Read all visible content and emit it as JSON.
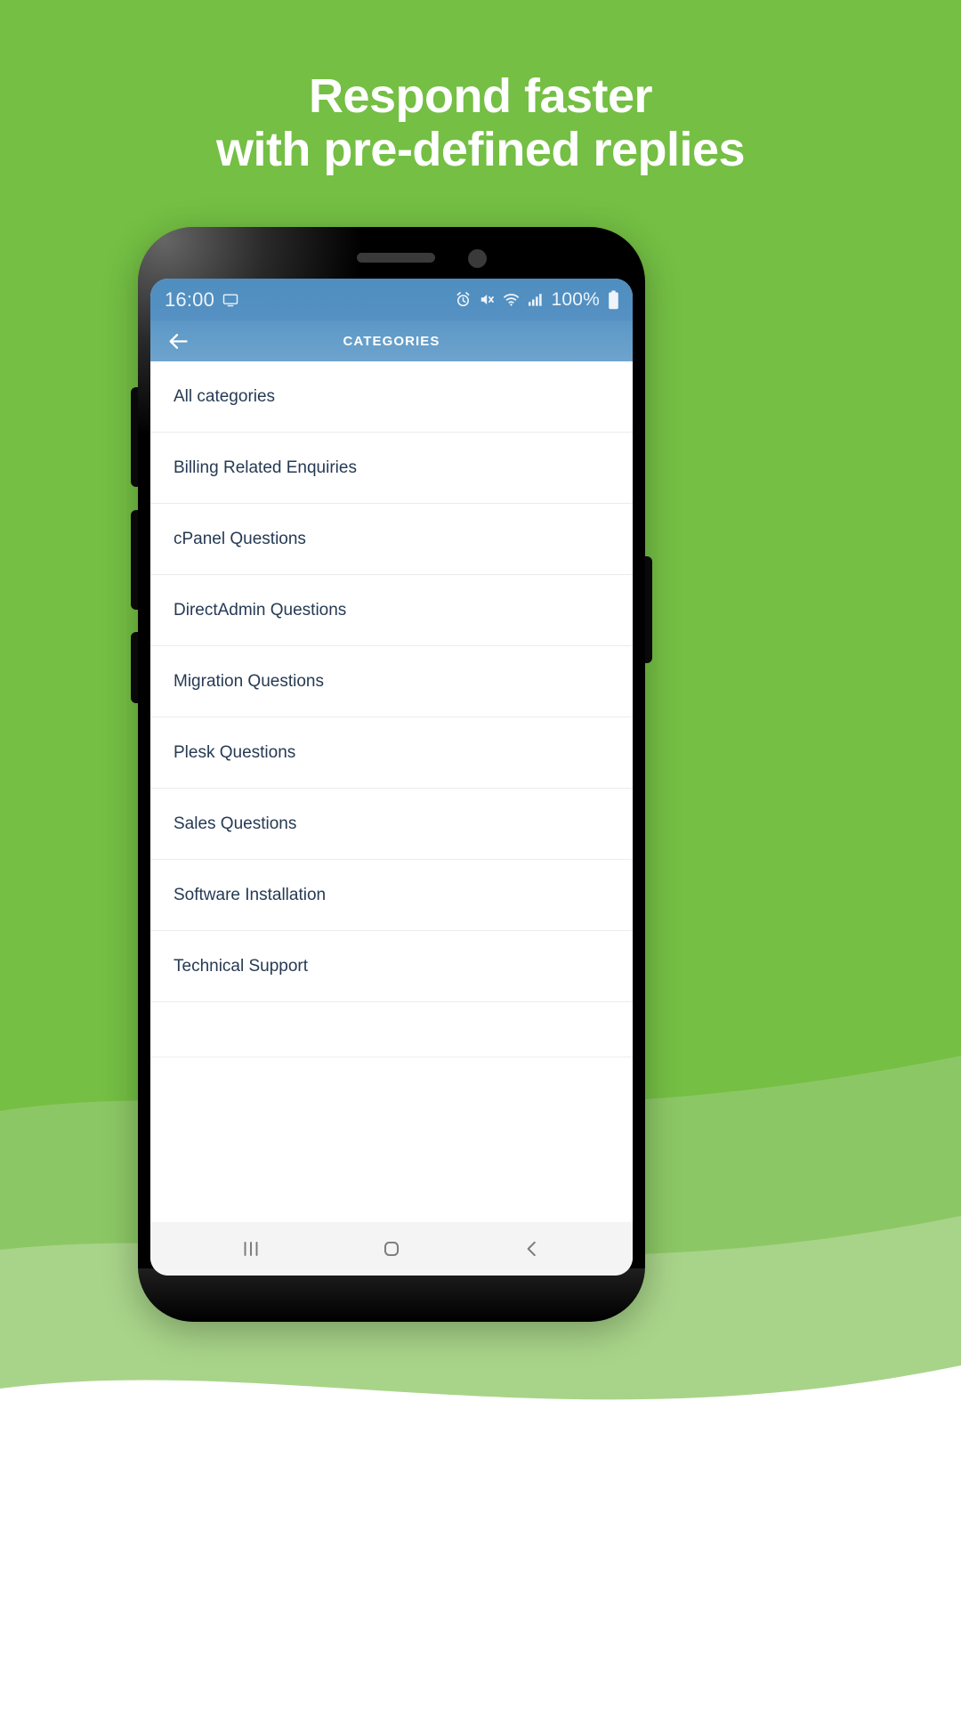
{
  "colors": {
    "brand_green": "#74bf44",
    "wave_mid": "#8cc765",
    "wave_light": "#a8d489",
    "page_white": "#ffffff",
    "status_bar_blue": "#4f8ec0",
    "app_bar_blue": "#6ea4cd",
    "list_text": "#263a53",
    "headline_text": "#ffffff"
  },
  "headline": {
    "line1": "Respond faster",
    "line2": "with pre-defined replies"
  },
  "phone": {
    "speaker": "speaker-slot",
    "camera": "front-camera-icon",
    "buttons": {
      "volume_up": "volume-up-button",
      "volume_down": "volume-down-button",
      "bixby": "bixby-button",
      "power": "power-button"
    }
  },
  "status_bar": {
    "time": "16:00",
    "cast_icon": "screencast-icon",
    "icons": [
      "alarm-icon",
      "mute-icon",
      "wifi-icon",
      "signal-icon"
    ],
    "battery_percent": "100%",
    "battery_icon": "battery-full-icon"
  },
  "app_bar": {
    "back_icon": "back-arrow-icon",
    "title": "CATEGORIES"
  },
  "categories": [
    {
      "label": "All categories"
    },
    {
      "label": "Billing Related Enquiries"
    },
    {
      "label": "cPanel Questions"
    },
    {
      "label": "DirectAdmin Questions"
    },
    {
      "label": "Migration Questions"
    },
    {
      "label": "Plesk Questions"
    },
    {
      "label": "Sales Questions"
    },
    {
      "label": "Software Installation"
    },
    {
      "label": "Technical Support"
    }
  ],
  "nav_bar": {
    "recents": "recents-icon",
    "home": "home-icon",
    "back": "back-icon"
  }
}
